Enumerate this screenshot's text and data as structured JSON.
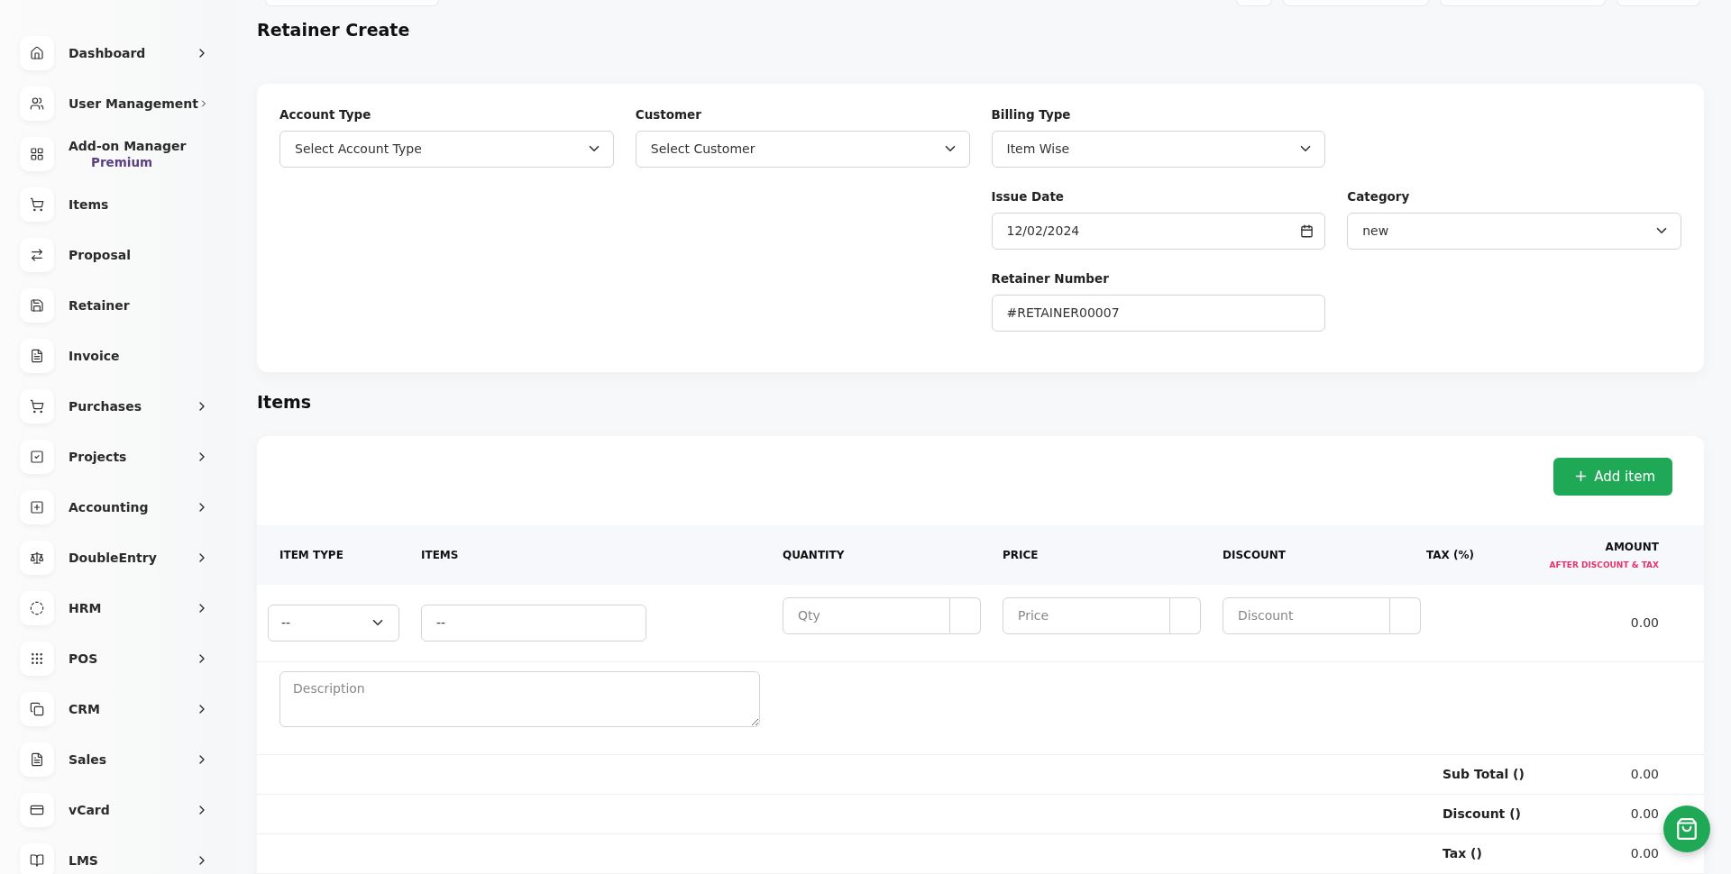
{
  "sidebar": {
    "items": [
      {
        "label": "Dashboard",
        "expandable": true
      },
      {
        "label": "User Management",
        "expandable": true
      },
      {
        "label": "Add-on Manager",
        "subtitle": "Premium",
        "expandable": false
      },
      {
        "label": "Items",
        "expandable": false
      },
      {
        "label": "Proposal",
        "expandable": false
      },
      {
        "label": "Retainer",
        "expandable": false
      },
      {
        "label": "Invoice",
        "expandable": false
      },
      {
        "label": "Purchases",
        "expandable": true
      },
      {
        "label": "Projects",
        "expandable": true
      },
      {
        "label": "Accounting",
        "expandable": true
      },
      {
        "label": "DoubleEntry",
        "expandable": true
      },
      {
        "label": "HRM",
        "expandable": true
      },
      {
        "label": "POS",
        "expandable": true
      },
      {
        "label": "CRM",
        "expandable": true
      },
      {
        "label": "Sales",
        "expandable": true
      },
      {
        "label": "vCard",
        "expandable": true
      },
      {
        "label": "LMS",
        "expandable": true
      }
    ]
  },
  "page_title": "Retainer Create",
  "form": {
    "fields": [
      {
        "label": "Account Type",
        "kind": "select",
        "value": "Select Account Type"
      },
      {
        "label": "Customer",
        "kind": "select",
        "value": "Select Customer"
      },
      {
        "label": "Billing Type",
        "kind": "select",
        "value": "Item Wise"
      },
      {
        "label": "Issue Date",
        "kind": "date",
        "value": "12/02/2024"
      },
      {
        "label": "Category",
        "kind": "select",
        "value": "new"
      },
      {
        "label": "Retainer Number",
        "kind": "text",
        "value": "#RETAINER00007"
      }
    ]
  },
  "items_section": {
    "title": "Items",
    "add_button": "Add item",
    "columns": [
      {
        "label": "ITEM TYPE"
      },
      {
        "label": "ITEMS"
      },
      {
        "label": "QUANTITY"
      },
      {
        "label": "PRICE"
      },
      {
        "label": "DISCOUNT"
      },
      {
        "label": "TAX (%)"
      },
      {
        "label": "AMOUNT",
        "note": "AFTER DISCOUNT & TAX"
      }
    ],
    "row": {
      "item_type": "--",
      "item": "--",
      "quantity_placeholder": "Qty",
      "price_placeholder": "Price",
      "discount_placeholder": "Discount",
      "amount": "0.00",
      "description_placeholder": "Description"
    },
    "totals": [
      {
        "label": "Sub Total ()",
        "value": "0.00"
      },
      {
        "label": "Discount ()",
        "value": "0.00"
      },
      {
        "label": "Tax ()",
        "value": "0.00"
      }
    ]
  }
}
